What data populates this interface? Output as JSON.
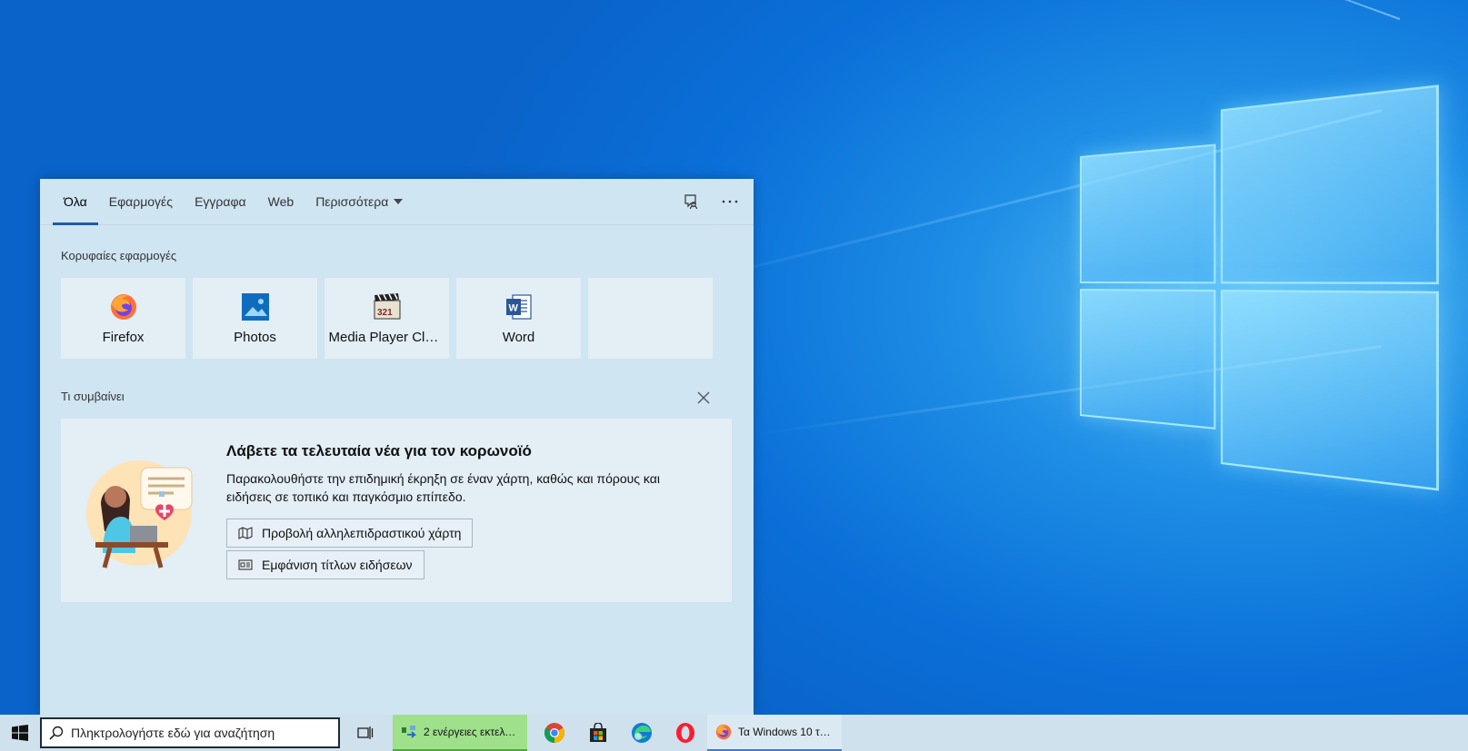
{
  "panel": {
    "tabs": [
      {
        "label": "Όλα",
        "active": true
      },
      {
        "label": "Εφαρμογές"
      },
      {
        "label": "Εγγραφα"
      },
      {
        "label": "Web"
      },
      {
        "label": "Περισσότερα"
      }
    ],
    "top_apps_label": "Κορυφαίες εφαρμογές",
    "top_apps": [
      {
        "name": "Firefox",
        "icon": "firefox-icon"
      },
      {
        "name": "Photos",
        "icon": "photos-icon"
      },
      {
        "name": "Media Player Clas...",
        "icon": "media-player-classic-icon"
      },
      {
        "name": "Word",
        "icon": "word-icon"
      },
      {
        "name": "",
        "icon": ""
      }
    ],
    "whats_new_label": "Τι συμβαίνει",
    "news": {
      "title": "Λάβετε τα τελευταία νέα για τον κορωνοϊό",
      "description": "Παρακολουθήστε την επιδημική έκρηξη σε έναν χάρτη, καθώς και πόρους και ειδήσεις σε τοπικό και παγκόσμιο επίπεδο.",
      "map_button": "Προβολή αλληλεπιδραστικού χάρτη",
      "headlines_button": "Εμφάνιση τίτλων ειδήσεων"
    }
  },
  "taskbar": {
    "search_placeholder": "Πληκτρολογήστε εδώ για αναζήτηση",
    "tasks": [
      {
        "label": "2 ενέργειες εκτελού...",
        "icon": "file-transfer-icon"
      },
      {
        "label": "Τα Windows 10 τώ...",
        "icon": "firefox-icon"
      }
    ],
    "pinned": [
      "task-view-icon",
      "chrome-icon",
      "store-icon",
      "edge-icon",
      "opera-icon"
    ]
  },
  "colors": {
    "accent": "#1f5aa8",
    "panel_bg": "#d6e9f3",
    "tile_bg": "#e3eef5",
    "taskbar_bg": "#cfe1ec",
    "progress_green": "#9fe08b"
  }
}
